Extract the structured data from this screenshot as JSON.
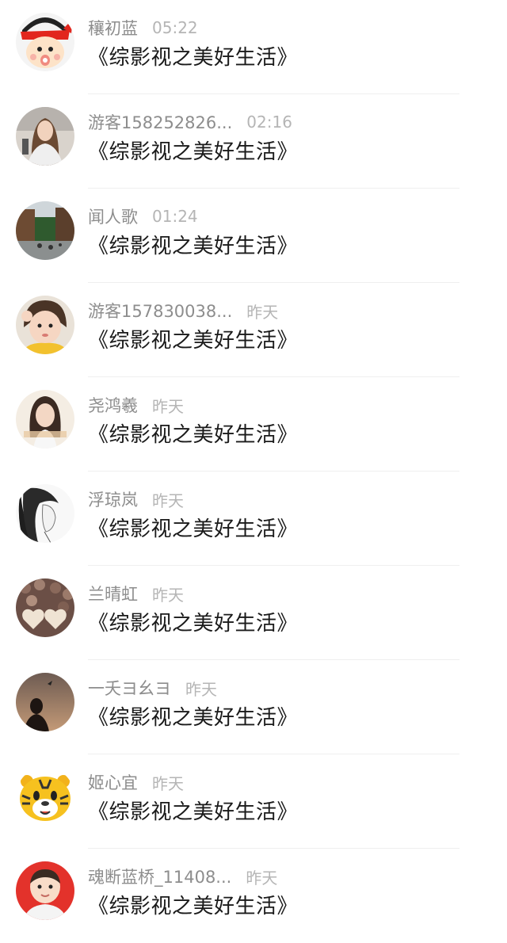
{
  "comments": [
    {
      "username": "穰初蓝",
      "time": "05:22",
      "content": "《综影视之美好生活》",
      "avatar_icon": "cartoon-boy-avatar-icon"
    },
    {
      "username": "游客158252826...",
      "time": "02:16",
      "content": "《综影视之美好生活》",
      "avatar_icon": "woman-photo-avatar-icon"
    },
    {
      "username": "闻人歌",
      "time": "01:24",
      "content": "《综影视之美好生活》",
      "avatar_icon": "street-photo-avatar-icon"
    },
    {
      "username": "游客157830038...",
      "time": "昨天",
      "content": "《综影视之美好生活》",
      "avatar_icon": "child-photo-avatar-icon"
    },
    {
      "username": "尧鸿羲",
      "time": "昨天",
      "content": "《综影视之美好生活》",
      "avatar_icon": "girl-photo-avatar-icon"
    },
    {
      "username": "浮琼岚",
      "time": "昨天",
      "content": "《综影视之美好生活》",
      "avatar_icon": "sketch-girl-avatar-icon"
    },
    {
      "username": "兰晴虹",
      "time": "昨天",
      "content": "《综影视之美好生活》",
      "avatar_icon": "hearts-avatar-icon"
    },
    {
      "username": "一夭ヨ幺ヨ",
      "time": "昨天",
      "content": "《综影视之美好生活》",
      "avatar_icon": "silhouette-avatar-icon"
    },
    {
      "username": "姬心宜",
      "time": "昨天",
      "content": "《综影视之美好生活》",
      "avatar_icon": "tiger-cartoon-avatar-icon"
    },
    {
      "username": "魂断蓝桥_11408...",
      "time": "昨天",
      "content": "《综影视之美好生活》",
      "avatar_icon": "baby-photo-avatar-icon"
    }
  ]
}
